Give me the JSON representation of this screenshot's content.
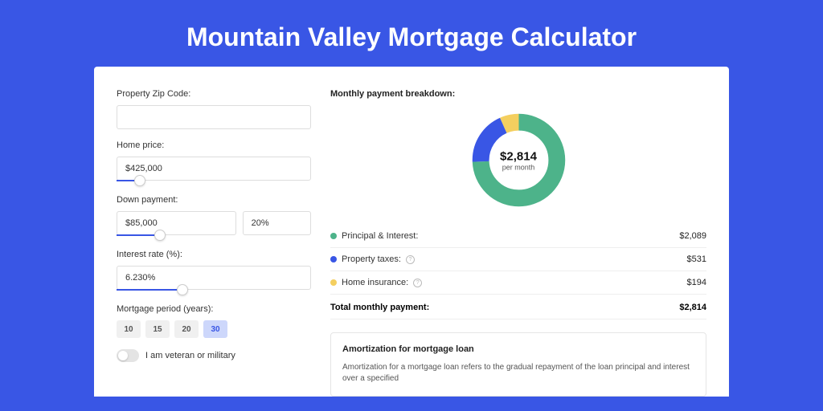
{
  "title": "Mountain Valley Mortgage Calculator",
  "form": {
    "zip_label": "Property Zip Code:",
    "zip_value": "",
    "home_price_label": "Home price:",
    "home_price_value": "$425,000",
    "down_payment_label": "Down payment:",
    "down_payment_value": "$85,000",
    "down_payment_pct": "20%",
    "interest_label": "Interest rate (%):",
    "interest_value": "6.230%",
    "period_label": "Mortgage period (years):",
    "periods": [
      "10",
      "15",
      "20",
      "30"
    ],
    "period_selected": "30",
    "veteran_label": "I am veteran or military"
  },
  "breakdown": {
    "title": "Monthly payment breakdown:",
    "donut_amount": "$2,814",
    "donut_sub": "per month",
    "rows": [
      {
        "label": "Principal & Interest:",
        "value": "$2,089",
        "color": "#4db38a",
        "info": false
      },
      {
        "label": "Property taxes:",
        "value": "$531",
        "color": "#3956e5",
        "info": true
      },
      {
        "label": "Home insurance:",
        "value": "$194",
        "color": "#f4cf5f",
        "info": true
      }
    ],
    "total_label": "Total monthly payment:",
    "total_value": "$2,814"
  },
  "chart_data": {
    "type": "pie",
    "title": "Monthly payment breakdown",
    "series": [
      {
        "name": "Principal & Interest",
        "value": 2089,
        "color": "#4db38a"
      },
      {
        "name": "Property taxes",
        "value": 531,
        "color": "#3956e5"
      },
      {
        "name": "Home insurance",
        "value": 194,
        "color": "#f4cf5f"
      }
    ],
    "total": 2814,
    "center_label": "$2,814 per month"
  },
  "amortization": {
    "title": "Amortization for mortgage loan",
    "text": "Amortization for a mortgage loan refers to the gradual repayment of the loan principal and interest over a specified"
  }
}
